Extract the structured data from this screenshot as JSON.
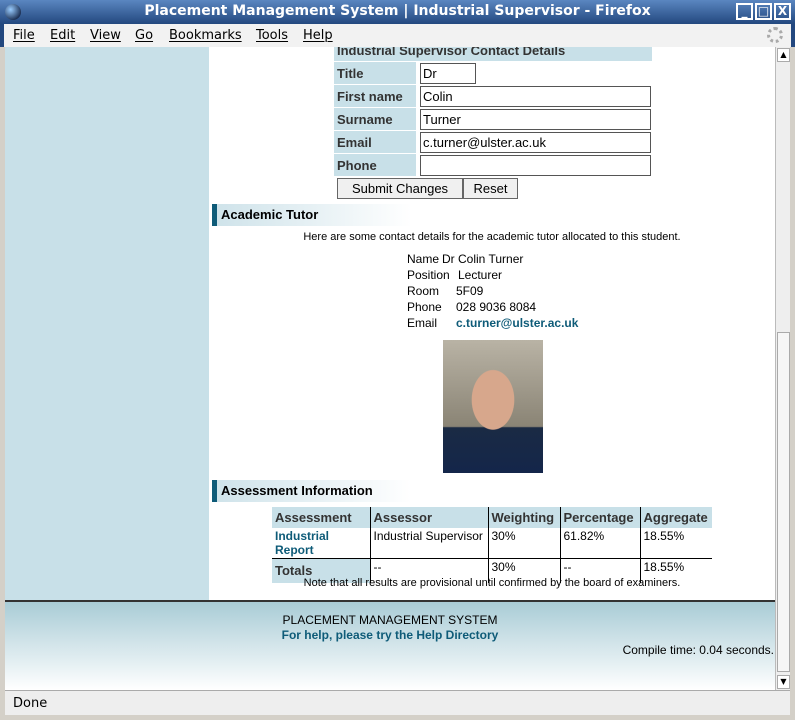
{
  "window": {
    "title": "Placement Management System | Industrial Supervisor - Firefox",
    "min": "_",
    "max": "□",
    "close": "X"
  },
  "menu": [
    "File",
    "Edit",
    "View",
    "Go",
    "Bookmarks",
    "Tools",
    "Help"
  ],
  "supervisor": {
    "heading": "Industrial Supervisor Contact Details",
    "fields": [
      {
        "label": "Title",
        "value": "Dr"
      },
      {
        "label": "First name",
        "value": "Colin"
      },
      {
        "label": "Surname",
        "value": "Turner"
      },
      {
        "label": "Email",
        "value": "c.turner@ulster.ac.uk"
      },
      {
        "label": "Phone",
        "value": ""
      }
    ],
    "submit": "Submit Changes",
    "reset": "Reset"
  },
  "tutor": {
    "heading": "Academic Tutor",
    "intro": "Here are some contact details for the academic tutor allocated to this student.",
    "rows": [
      {
        "k": "Name",
        "v": "Dr Colin Turner"
      },
      {
        "k": "Position",
        "v": "Lecturer"
      },
      {
        "k": "Room",
        "v": "5F09"
      },
      {
        "k": "Phone",
        "v": "028 9036 8084"
      },
      {
        "k": "Email",
        "v": "c.turner@ulster.ac.uk"
      }
    ]
  },
  "assessment": {
    "heading": "Assessment Information",
    "columns": [
      "Assessment",
      "Assessor",
      "Weighting",
      "Percentage",
      "Aggregate"
    ],
    "row": [
      "Industrial Report",
      "Industrial Supervisor",
      "30%",
      "61.82%",
      "18.55%"
    ],
    "totals": [
      "Totals",
      "--",
      "30%",
      "--",
      "18.55%"
    ],
    "note": "Note that all results are provisional until confirmed by the board of examiners."
  },
  "footer": {
    "system": "PLACEMENT MANAGEMENT SYSTEM",
    "help": "For help, please try the Help Directory",
    "compile": "Compile time: 0.04 seconds."
  },
  "status": "Done"
}
